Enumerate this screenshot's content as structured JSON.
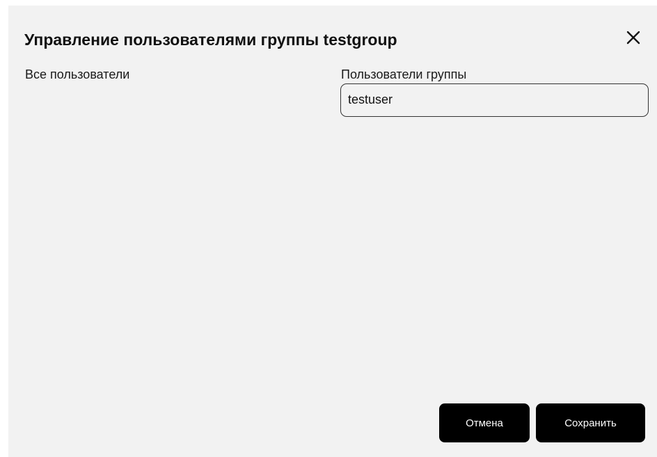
{
  "dialog": {
    "title": "Управление пользователями группы testgroup",
    "close_icon": "close-icon"
  },
  "all_users": {
    "label": "Все пользователи",
    "items": []
  },
  "group_users": {
    "label": "Пользователи группы",
    "items": [
      {
        "name": "testuser"
      }
    ]
  },
  "footer": {
    "cancel_label": "Отмена",
    "save_label": "Сохранить"
  },
  "colors": {
    "dialog_background": "#f2f2f2",
    "button_background": "#000000",
    "button_text": "#ffffff",
    "item_border": "#333333"
  }
}
